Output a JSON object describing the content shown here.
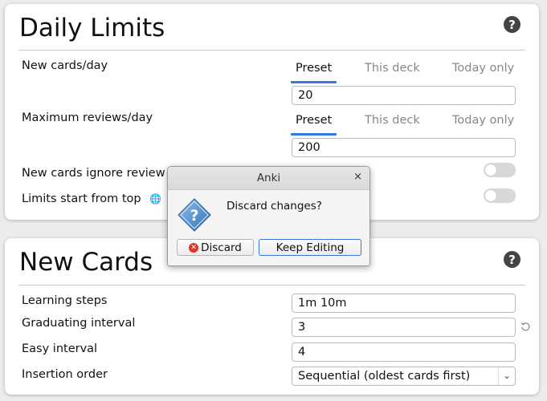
{
  "daily_limits": {
    "title": "Daily Limits",
    "help_glyph": "?",
    "new_cards_label": "New cards/day",
    "new_cards_tabs": [
      "Preset",
      "This deck",
      "Today only"
    ],
    "new_cards_value": "20",
    "max_reviews_label": "Maximum reviews/day",
    "max_reviews_tabs": [
      "Preset",
      "This deck",
      "Today only"
    ],
    "max_reviews_value": "200",
    "ignore_review_label": "New cards ignore review l",
    "limits_top_label": "Limits start from top",
    "globe_icon_glyph": "🌐"
  },
  "new_cards": {
    "title": "New Cards",
    "help_glyph": "?",
    "learning_steps_label": "Learning steps",
    "learning_steps_value": "1m 10m",
    "graduating_label": "Graduating interval",
    "graduating_value": "3",
    "easy_label": "Easy interval",
    "easy_value": "4",
    "insertion_label": "Insertion order",
    "insertion_value": "Sequential (oldest cards first)"
  },
  "dialog": {
    "title": "Anki",
    "close_glyph": "×",
    "message": "Discard changes?",
    "discard_label": "Discard",
    "keep_label": "Keep Editing"
  },
  "colors": {
    "accent": "#3478db",
    "discard_red": "#d8382b"
  }
}
